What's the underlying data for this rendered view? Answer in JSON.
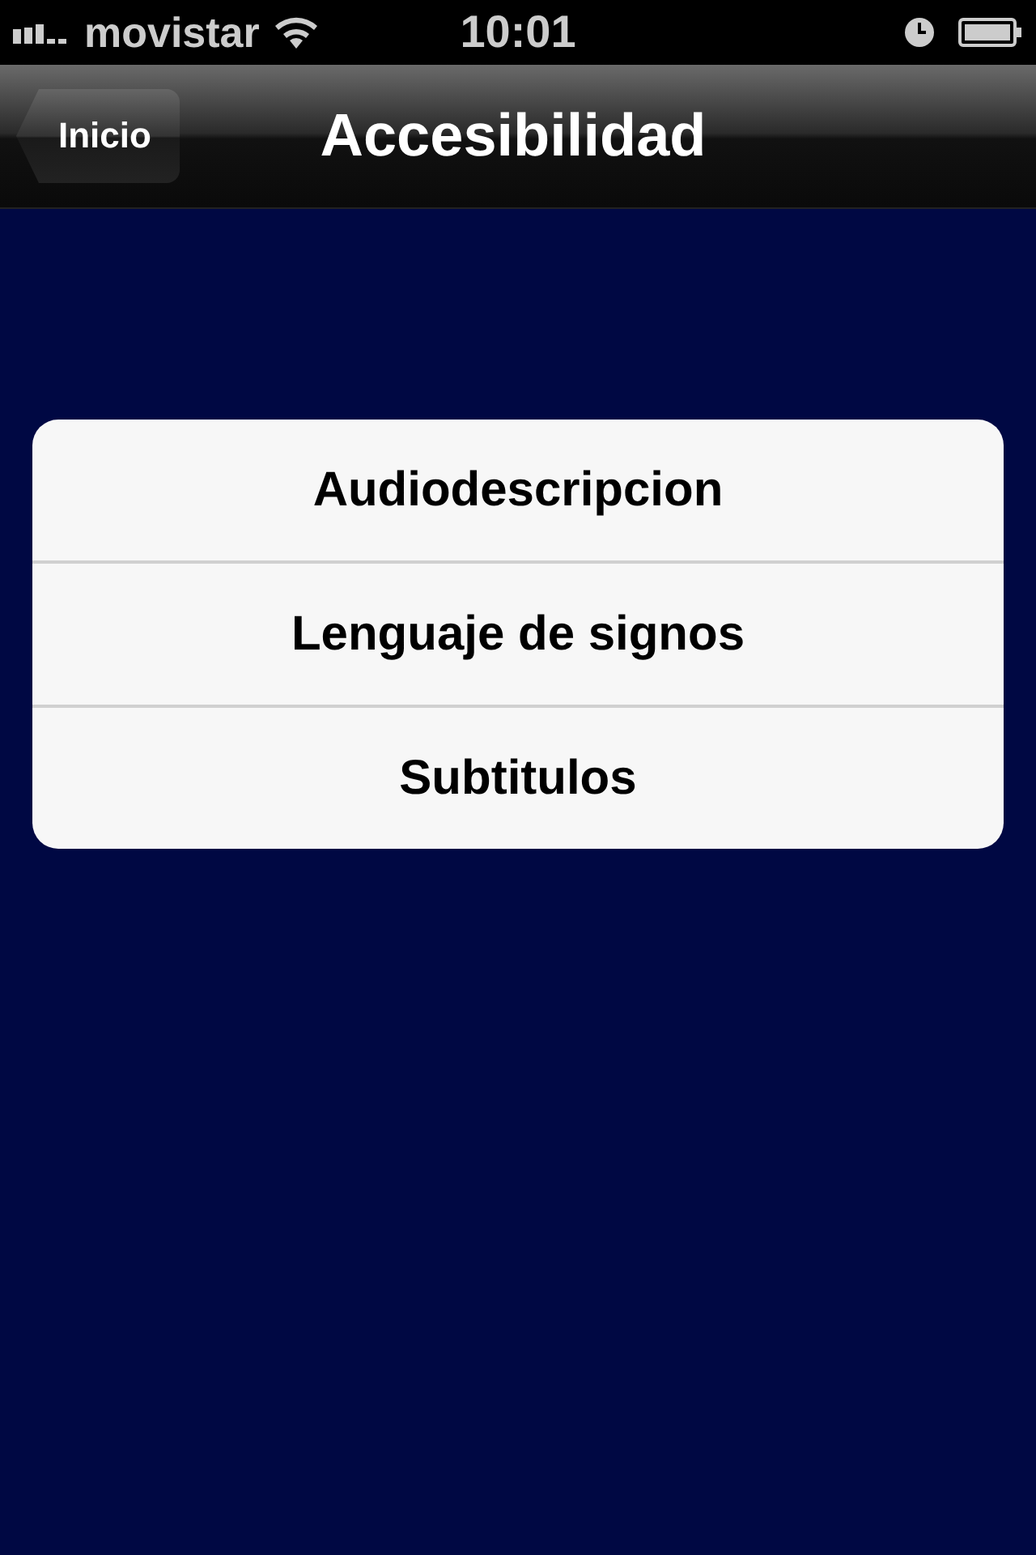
{
  "status_bar": {
    "carrier": "movistar",
    "time": "10:01"
  },
  "nav_bar": {
    "back": "Inicio",
    "title": "Accesibilidad"
  },
  "menu": [
    {
      "label": "Audiodescripcion"
    },
    {
      "label": "Lenguaje de signos"
    },
    {
      "label": "Subtitulos"
    }
  ]
}
